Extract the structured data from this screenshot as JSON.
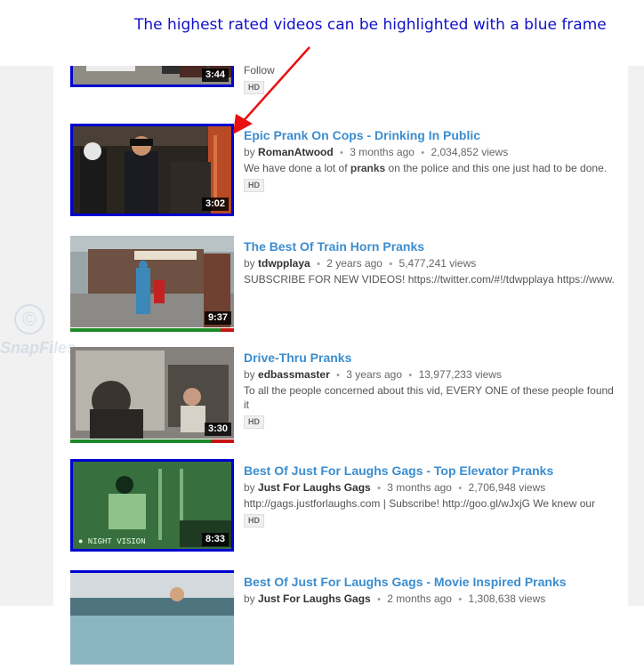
{
  "annotation": "The highest rated videos can be highlighted with a blue frame",
  "watermark": {
    "symbol": "©",
    "text": "SnapFiles"
  },
  "colors": {
    "frame": "#0000d0",
    "link": "#3b8dd0",
    "rating_good": "#1c8a28",
    "rating_bad": "#c61414",
    "arrow": "#e81010"
  },
  "videos": [
    {
      "title": "",
      "owner": "",
      "age": "",
      "views": "",
      "by": "",
      "desc": "Follow",
      "duration": "3:44",
      "hd": "HD",
      "highlighted": true,
      "rating": 0.95
    },
    {
      "title": "Epic Prank On Cops - Drinking In Public",
      "by": "by",
      "owner": "RomanAtwood",
      "age": "3 months ago",
      "views": "2,034,852 views",
      "desc_pre": "We have done a lot of ",
      "desc_bold": "pranks",
      "desc_post": " on the police and this one just had to be done.",
      "duration": "3:02",
      "hd": "HD",
      "highlighted": true,
      "rating": 0.97
    },
    {
      "title": "The Best Of Train Horn Pranks",
      "by": "by",
      "owner": "tdwpplaya",
      "age": "2 years ago",
      "views": "5,477,241 views",
      "desc": "SUBSCRIBE FOR NEW VIDEOS! https://twitter.com/#!/tdwpplaya https://www.",
      "duration": "9:37",
      "hd": "",
      "highlighted": false,
      "rating": 0.93
    },
    {
      "title": "Drive-Thru Pranks",
      "by": "by",
      "owner": "edbassmaster",
      "age": "3 years ago",
      "views": "13,977,233 views",
      "desc": "To all the people concerned about this vid, EVERY ONE of these people found it",
      "duration": "3:30",
      "hd": "HD",
      "highlighted": false,
      "rating": 0.86
    },
    {
      "title": "Best Of Just For Laughs Gags - Top Elevator Pranks",
      "by": "by",
      "owner": "Just For Laughs Gags",
      "age": "3 months ago",
      "views": "2,706,948 views",
      "desc": "http://gags.justforlaughs.com | Subscribe! http://goo.gl/wJxjG We knew our",
      "duration": "8:33",
      "hd": "HD",
      "highlighted": true,
      "rating": 0.96
    },
    {
      "title": "Best Of Just For Laughs Gags - Movie Inspired Pranks",
      "by": "by",
      "owner": "Just For Laughs Gags",
      "age": "2 months ago",
      "views": "1,308,638 views",
      "desc": "",
      "duration": "",
      "hd": "",
      "highlighted": false,
      "rating": 0.95
    }
  ]
}
